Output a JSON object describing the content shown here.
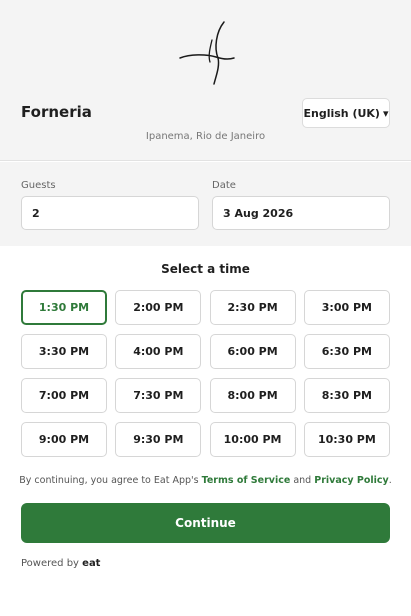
{
  "header": {
    "restaurant_name": "Forneria",
    "language_label": "English (UK)",
    "language_caret": "▾",
    "location": "Ipanema, Rio de Janeiro"
  },
  "filters": {
    "guests_label": "Guests",
    "guests_value": "2",
    "date_label": "Date",
    "date_value": "3 Aug 2026"
  },
  "time_section": {
    "title": "Select a time",
    "selected": "1:30 PM",
    "slots": [
      "1:30 PM",
      "2:00 PM",
      "2:30 PM",
      "3:00 PM",
      "3:30 PM",
      "4:00 PM",
      "6:00 PM",
      "6:30 PM",
      "7:00 PM",
      "7:30 PM",
      "8:00 PM",
      "8:30 PM",
      "9:00 PM",
      "9:30 PM",
      "10:00 PM",
      "10:30 PM"
    ]
  },
  "terms": {
    "prefix": "By continuing, you agree to Eat App's",
    "tos": "Terms of Service",
    "and": "and",
    "privacy": "Privacy Policy",
    "suffix": "."
  },
  "continue_label": "Continue",
  "footer": {
    "powered_by": "Powered by",
    "brand": "eat"
  },
  "colors": {
    "accent": "#2f7a3a",
    "header_bg": "#f4f4f4"
  }
}
